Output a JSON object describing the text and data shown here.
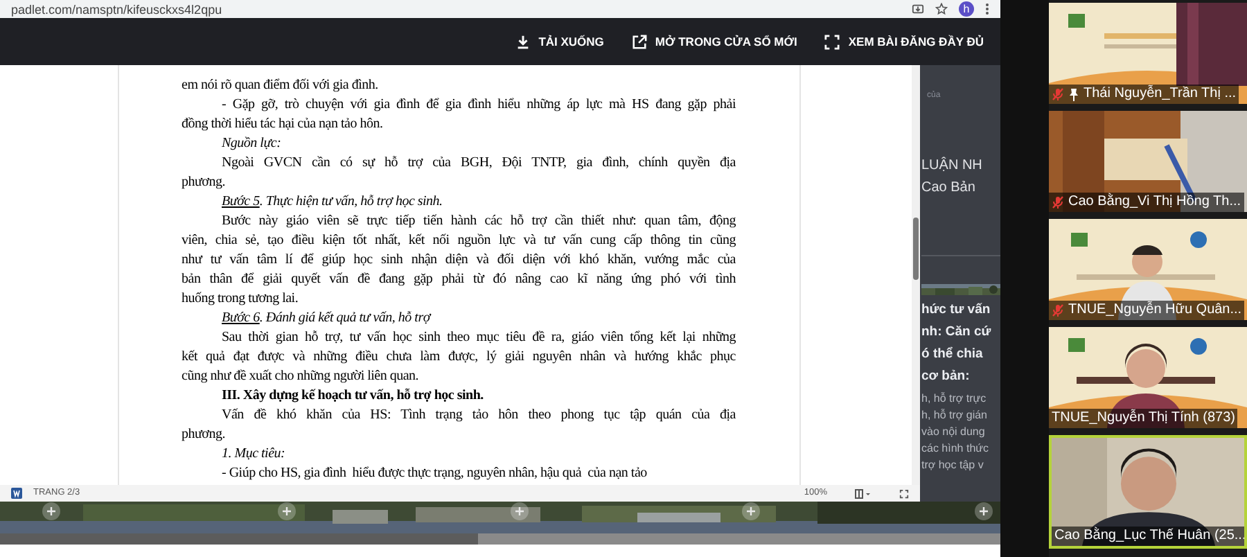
{
  "browser": {
    "url": "padlet.com/namsptn/kifeusckxs4l2qpu",
    "profile_initial": "h"
  },
  "toolbar": {
    "buttons": [
      {
        "kind": "download",
        "label": "TẢI XUỐNG"
      },
      {
        "kind": "open_new",
        "label": "MỞ TRONG CỬA SỔ MỚI"
      },
      {
        "kind": "fullscreen",
        "label": "XEM BÀI ĐĂNG ĐẦY ĐỦ"
      }
    ]
  },
  "document": {
    "paragraphs": [
      {
        "kind": "text",
        "indent": false,
        "lines": [
          "em nói rõ quan điểm đối với gia đình."
        ]
      },
      {
        "kind": "text",
        "indent": true,
        "lines": [
          "- Gặp gỡ, trò chuyện với gia đình để gia đình hiểu những áp lực mà HS đang gặp phải",
          "đồng thời hiểu tác hại của nạn tảo hôn."
        ]
      },
      {
        "kind": "italic",
        "indent": true,
        "lines": [
          "Nguồn lực:"
        ]
      },
      {
        "kind": "text",
        "indent": true,
        "lines": [
          "Ngoài GVCN cần có sự hỗ trợ của BGH, Đội TNTP, gia đình, chính quyền địa",
          "phương."
        ]
      },
      {
        "kind": "step",
        "indent": true,
        "label": "Bước 5",
        "lines": [
          ". Thực hiện tư vấn, hỗ trợ học sinh."
        ]
      },
      {
        "kind": "text",
        "indent": true,
        "lines": [
          "Bước này giáo viên sẽ trực tiếp tiến hành các hỗ trợ cần thiết như: quan tâm, động",
          "viên, chia sẻ, tạo điều kiện tốt nhất, kết nối nguồn lực và tư vấn cung cấp thông tin cũng",
          "như tư vấn tâm lí để giúp học sinh nhận diện và đối diện với khó khăn, vướng mắc của",
          "bản thân để giải quyết vấn đề đang gặp phải từ đó nâng cao kĩ năng ứng phó với tình",
          "huống trong tương lai."
        ]
      },
      {
        "kind": "step",
        "indent": true,
        "label": "Bước 6",
        "lines": [
          ". Đánh giá kết quả tư vấn, hỗ trợ"
        ]
      },
      {
        "kind": "text",
        "indent": true,
        "lines": [
          "Sau thời gian hỗ trợ, tư vấn học sinh theo mục tiêu đề ra, giáo viên tổng kết lại những",
          "kết quả đạt được và những điều chưa làm được, lý giải nguyên nhân và hướng khắc phục",
          "cũng như đề xuất cho những người liên quan."
        ]
      },
      {
        "kind": "heading",
        "indent": true,
        "lines": [
          "III. Xây dựng kế hoạch tư vấn, hỗ trợ học sinh."
        ]
      },
      {
        "kind": "text",
        "indent": true,
        "lines": [
          "Vấn đề khó khăn của HS: Tình trạng tảo hôn theo phong tục tập quán của địa",
          "phương."
        ]
      },
      {
        "kind": "italic",
        "indent": true,
        "lines": [
          "1. Mục tiêu:"
        ]
      },
      {
        "kind": "text",
        "indent": true,
        "lines": [
          "- Giúp cho HS, gia đình  hiểu được thực trạng, nguyên nhân, hậu quả  của nạn tảo"
        ]
      }
    ],
    "status_bar": {
      "page": "TRANG 2/3",
      "zoom": "100%"
    }
  },
  "background_post": {
    "caption": "của",
    "titles": [
      "LUẬN NH",
      "Cao Bản"
    ],
    "headings": [
      "hức tư vấn",
      "nh: Căn cứ",
      "ó thể chia",
      "cơ bản:"
    ],
    "body": [
      "h, hỗ trợ trực",
      "h, hỗ trợ gián",
      "vào nội dung",
      "các hình thức",
      "trợ học tập v"
    ]
  },
  "participants": [
    {
      "name": "Thái Nguyễn_Trần Thị ...",
      "muted": true,
      "pinned": true,
      "active": false
    },
    {
      "name": "Cao Bằng_Vi Thị Hồng Th...",
      "muted": true,
      "pinned": false,
      "active": false
    },
    {
      "name": "TNUE_Nguyễn Hữu Quân...",
      "muted": true,
      "pinned": false,
      "active": false
    },
    {
      "name": "TNUE_Nguyễn Thị Tính (873)",
      "muted": false,
      "pinned": false,
      "active": false
    },
    {
      "name": "Cao Bằng_Lục Thế Huân (25...",
      "muted": false,
      "pinned": false,
      "active": true
    }
  ]
}
